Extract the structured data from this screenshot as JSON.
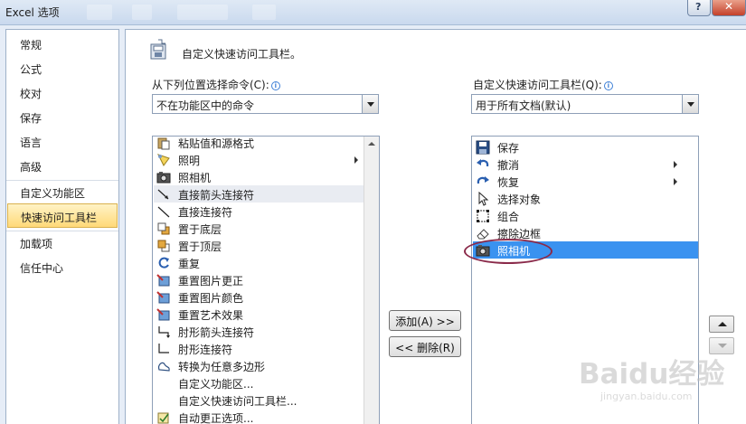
{
  "window": {
    "title": "Excel 选项",
    "help_label": "?",
    "close_label": "✕"
  },
  "nav": {
    "items": [
      {
        "label": "常规"
      },
      {
        "label": "公式"
      },
      {
        "label": "校对"
      },
      {
        "label": "保存"
      },
      {
        "label": "语言"
      },
      {
        "label": "高级"
      },
      {
        "label": "自定义功能区"
      },
      {
        "label": "快速访问工具栏"
      },
      {
        "label": "加载项"
      },
      {
        "label": "信任中心"
      }
    ],
    "active_index": 7
  },
  "header": {
    "title": "自定义快速访问工具栏。"
  },
  "left_panel": {
    "label": "从下列位置选择命令(C):",
    "combo_value": "不在功能区中的命令",
    "items": [
      {
        "label": "粘贴值和源格式",
        "icon": "paste-icon"
      },
      {
        "label": "照明",
        "icon": "lighting-icon",
        "submenu": true
      },
      {
        "label": "照相机",
        "icon": "camera-icon"
      },
      {
        "label": "直接箭头连接符",
        "icon": "straight-arrow-connector-icon",
        "hover": true
      },
      {
        "label": "直接连接符",
        "icon": "straight-connector-icon"
      },
      {
        "label": "置于底层",
        "icon": "send-to-back-icon"
      },
      {
        "label": "置于顶层",
        "icon": "bring-to-front-icon"
      },
      {
        "label": "重复",
        "icon": "repeat-icon"
      },
      {
        "label": "重置图片更正",
        "icon": "reset-picture-correction-icon"
      },
      {
        "label": "重置图片颜色",
        "icon": "reset-picture-color-icon"
      },
      {
        "label": "重置艺术效果",
        "icon": "reset-artistic-effects-icon"
      },
      {
        "label": "肘形箭头连接符",
        "icon": "elbow-arrow-connector-icon"
      },
      {
        "label": "肘形连接符",
        "icon": "elbow-connector-icon"
      },
      {
        "label": "转换为任意多边形",
        "icon": "freeform-icon"
      },
      {
        "label": "自定义功能区...",
        "icon": ""
      },
      {
        "label": "自定义快速访问工具栏...",
        "icon": ""
      },
      {
        "label": "自动更正选项...",
        "icon": "autocorrect-icon"
      }
    ]
  },
  "middle": {
    "add_label": "添加(A) >>",
    "remove_label": "<< 删除(R)"
  },
  "right_panel": {
    "label": "自定义快速访问工具栏(Q):",
    "combo_value": "用于所有文档(默认)",
    "items": [
      {
        "label": "保存",
        "icon": "save-icon"
      },
      {
        "label": "撤消",
        "icon": "undo-icon",
        "submenu": true
      },
      {
        "label": "恢复",
        "icon": "redo-icon",
        "submenu": true
      },
      {
        "label": "选择对象",
        "icon": "select-objects-icon"
      },
      {
        "label": "组合",
        "icon": "group-icon"
      },
      {
        "label": "擦除边框",
        "icon": "eraser-icon"
      },
      {
        "label": "照相机",
        "icon": "camera-icon",
        "selected": true
      }
    ]
  },
  "watermark": {
    "brand": "Baidu经验",
    "url": "jingyan.baidu.com"
  },
  "colors": {
    "selection": "#3a92f0",
    "active_nav": "#ffd978",
    "annotation_ellipse": "#8a2a4a"
  }
}
